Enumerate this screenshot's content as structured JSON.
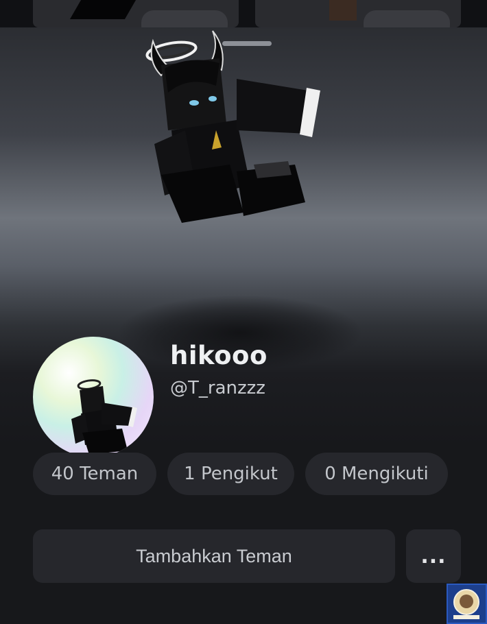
{
  "profile": {
    "display_name": "hikooo",
    "username": "@T_ranzzz"
  },
  "stats": {
    "friends": "40 Teman",
    "followers": "1 Pengikut",
    "following": "0 Mengikuti"
  },
  "actions": {
    "add_friend": "Tambahkan Teman",
    "more": "..."
  },
  "icons": {
    "more": "ellipsis-icon",
    "watermark": "badge-logo-icon"
  },
  "colors": {
    "background": "#17181b",
    "button": "#26272c",
    "text": "#e9eaec"
  }
}
